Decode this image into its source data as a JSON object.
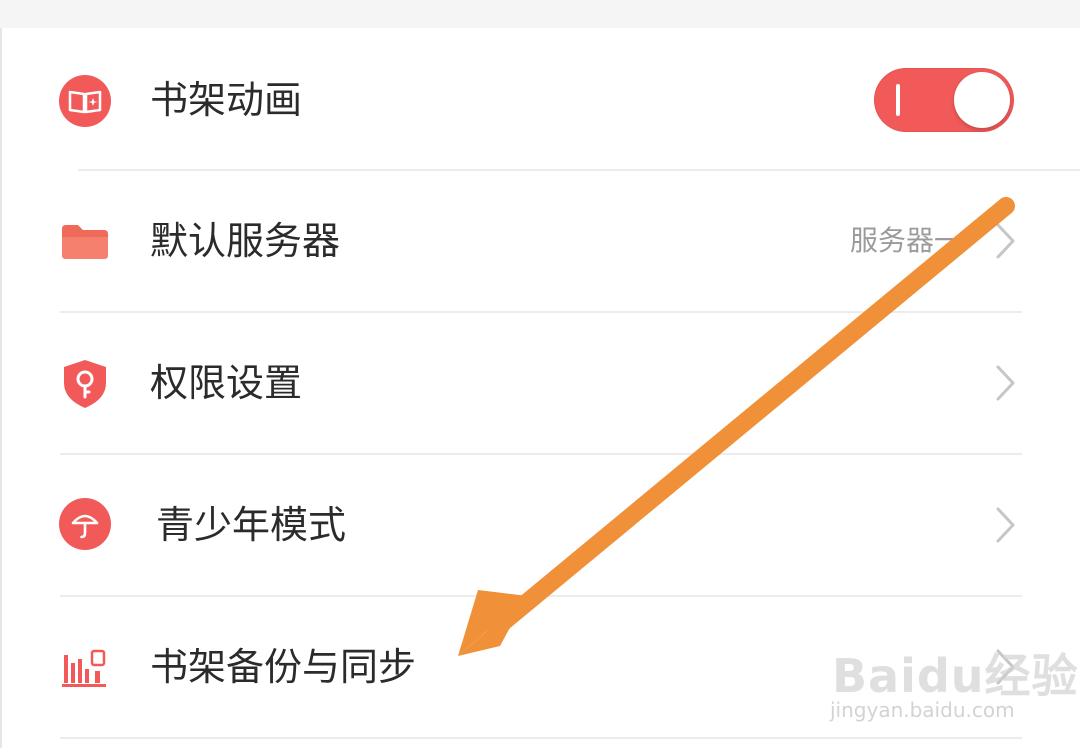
{
  "settings": {
    "items": [
      {
        "label": "书架动画",
        "icon": "book-sparkle-icon",
        "control": "toggle",
        "toggle_on": true
      },
      {
        "label": "默认服务器",
        "icon": "folder-icon",
        "control": "chevron",
        "value": "服务器一"
      },
      {
        "label": "权限设置",
        "icon": "shield-key-icon",
        "control": "chevron"
      },
      {
        "label": "青少年模式",
        "icon": "umbrella-icon",
        "control": "chevron"
      },
      {
        "label": "书架备份与同步",
        "icon": "bar-chart-icon",
        "control": "chevron"
      }
    ]
  },
  "colors": {
    "accent": "#f25a5a",
    "annotation_arrow": "#f0913a",
    "text_primary": "#2b2b2b",
    "text_secondary": "#9b9b9b",
    "divider": "#ececec"
  },
  "watermark": {
    "brand": "Baidu经验",
    "url": "jingyan.baidu.com"
  }
}
